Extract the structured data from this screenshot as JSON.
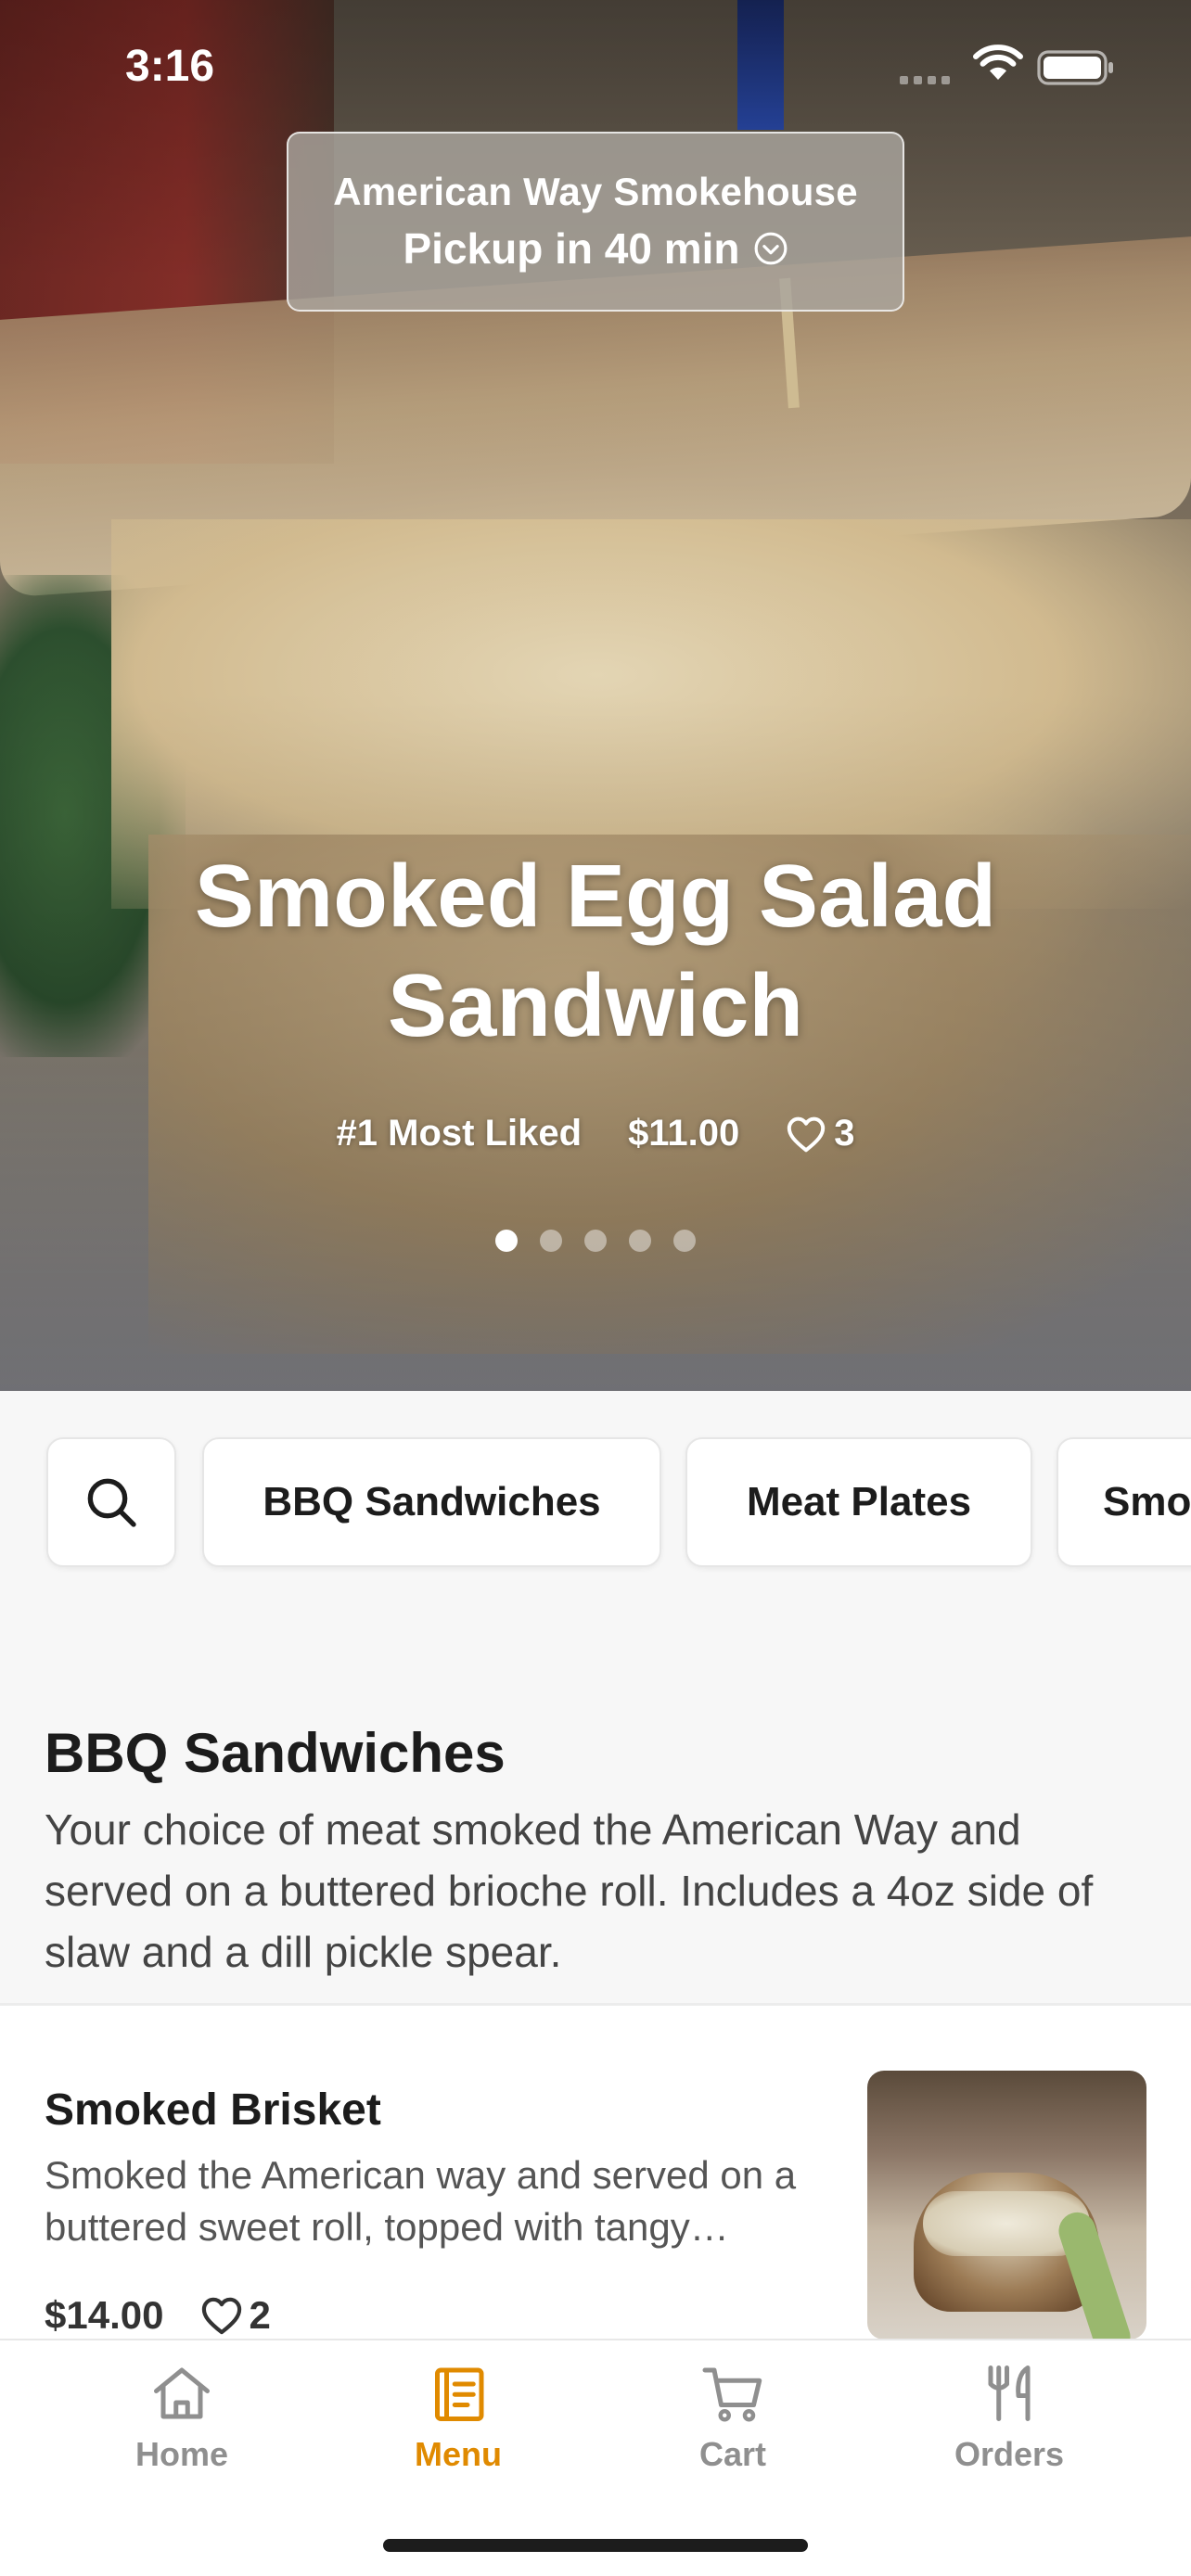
{
  "status_bar": {
    "time": "3:16"
  },
  "pickup": {
    "restaurant": "American Way Smokehouse",
    "pickup_text": "Pickup in 40 min"
  },
  "hero": {
    "title": "Smoked Egg Salad Sandwich",
    "badge": "#1 Most Liked",
    "price": "$11.00",
    "likes": "3",
    "carousel": {
      "total": 5,
      "active_index": 0
    }
  },
  "categories": [
    {
      "label": "BBQ Sandwiches"
    },
    {
      "label": "Meat Plates"
    },
    {
      "label": "Smo"
    }
  ],
  "section": {
    "title": "BBQ Sandwiches",
    "description": "Your choice of meat smoked the American Way and served on a buttered brioche roll. Includes a 4oz side of slaw and a dill pickle spear."
  },
  "items": [
    {
      "name": "Smoked Brisket",
      "description": "Smoked the American way and served on a buttered sweet roll, topped with tangy…",
      "price": "$14.00",
      "likes": "2"
    }
  ],
  "tabbar": {
    "tabs": [
      {
        "label": "Home",
        "icon": "house-icon"
      },
      {
        "label": "Menu",
        "icon": "menu-icon"
      },
      {
        "label": "Cart",
        "icon": "cart-icon"
      },
      {
        "label": "Orders",
        "icon": "fork-knife-icon"
      }
    ],
    "active_tab": "Menu"
  },
  "colors": {
    "accent": "#E08A00",
    "inactive": "#8F8F8F",
    "background": "#F7F7F7"
  }
}
